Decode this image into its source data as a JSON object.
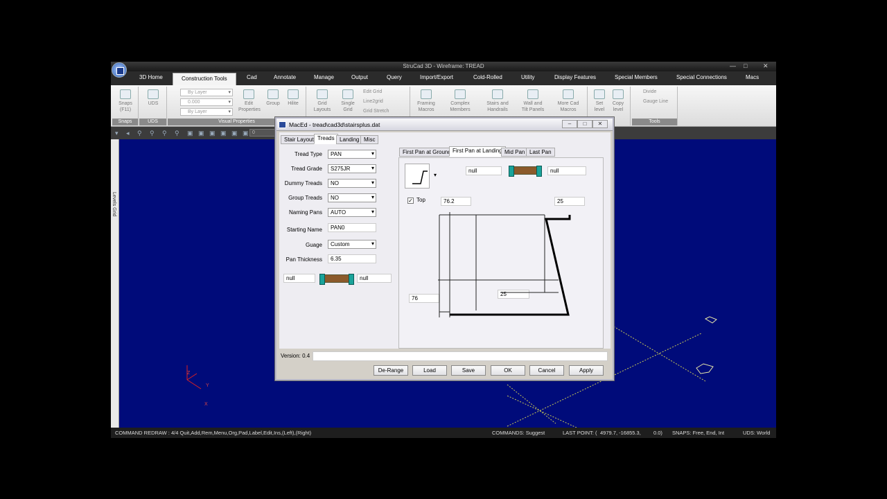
{
  "window": {
    "title": "StruCad 3D - Wireframe: TREAD",
    "controls": [
      "—",
      "□",
      "✕"
    ]
  },
  "ribbon": {
    "tabs": [
      "3D Home",
      "Construction Tools",
      "Cad",
      "Annotate",
      "Manage",
      "Output",
      "Query",
      "Import/Export",
      "Cold-Rolled",
      "Utility",
      "Display Features",
      "Special Members",
      "Special Connections",
      "Macs"
    ],
    "active_tab": "Construction Tools",
    "groups": {
      "snaps": {
        "label": "Snaps",
        "button": "Snaps",
        "sub": "(F11)"
      },
      "uds": {
        "label": "UDS",
        "button": "UDS"
      },
      "visual_properties": {
        "label": "Visual Properties",
        "combo1": "By Layer",
        "combo2": "0.000",
        "combo3": "By Layer",
        "edit": "Edit",
        "edit2": "Properties",
        "group": "Group",
        "hilite": "Hilite"
      },
      "grid": {
        "grid_layouts": "Grid",
        "grid_layouts2": "Layouts",
        "single_grid": "Single",
        "single_grid2": "Grid",
        "edit_grid": "Edit Grid",
        "line2grid": "Line2grid",
        "grid_stretch": "Grid Stretch"
      },
      "macros": {
        "framing": "Framing",
        "framing2": "Macros",
        "complex": "Complex",
        "complex2": "Members",
        "stairs": "Stairs and",
        "stairs2": "Handrails",
        "wall": "Wall and",
        "wall2": "Tilt Panels",
        "more": "More Cad",
        "more2": "Macros"
      },
      "level": {
        "set": "Set",
        "set2": "level",
        "copy": "Copy",
        "copy2": "level"
      },
      "tools": {
        "label": "Tools",
        "divide": "Divide",
        "gauge": "Gauge Line"
      }
    }
  },
  "toolbar2": {
    "field_value": "0"
  },
  "left_strip": {
    "label": "Levels Grid"
  },
  "axes": {
    "z": "Z",
    "y": "Y",
    "x": "X"
  },
  "status": {
    "command": "COMMAND REDRAW : 4/4 Quit,Add,Rem,Menu,Org,Pad,Label,Edit,Ins,(Left),(Right)",
    "commands": "COMMANDS: Suggest",
    "last_point_label": "LAST POINT: (",
    "last_point": "4979.7,  -16855.3,",
    "last_point_z": "0.0)",
    "snaps": "SNAPS:  Free,  End, Int",
    "uds": "UDS: World"
  },
  "dialog": {
    "title": "MacEd - tread\\cad3d\\stairsplus.dat",
    "tabs": [
      "Stair Layout",
      "Treads",
      "Landing",
      "Misc"
    ],
    "active_tab": "Treads",
    "form": {
      "tread_type": {
        "label": "Tread Type",
        "value": "PAN"
      },
      "tread_grade": {
        "label": "Tread Grade",
        "value": "S275JR"
      },
      "dummy_treads": {
        "label": "Dummy Treads",
        "value": "NO"
      },
      "group_treads": {
        "label": "Group Treads",
        "value": "NO"
      },
      "naming_pans": {
        "label": "Naming Pans",
        "value": "AUTO"
      },
      "starting_name": {
        "label": "Starting Name",
        "value": "PAN0"
      },
      "gauge": {
        "label": "Guage",
        "value": "Custom"
      },
      "pan_thickness": {
        "label": "Pan Thickness",
        "value": "6.35"
      },
      "null_left": "null",
      "null_right": "null"
    },
    "panel": {
      "tabs": [
        "First Pan at Ground",
        "First Pan at Landing",
        "Mid Pan",
        "Last Pan"
      ],
      "active_tab": "First Pan at Landing",
      "null_left": "null",
      "null_right": "null",
      "top_label": "Top",
      "top_checked": true,
      "dim_top_left": "76.2",
      "dim_top_right": "25",
      "dim_mid": "25",
      "dim_left": "76"
    },
    "version": "Version: 0.4",
    "buttons": [
      "De-Range",
      "Load",
      "Save",
      "OK",
      "Cancel",
      "Apply"
    ]
  }
}
